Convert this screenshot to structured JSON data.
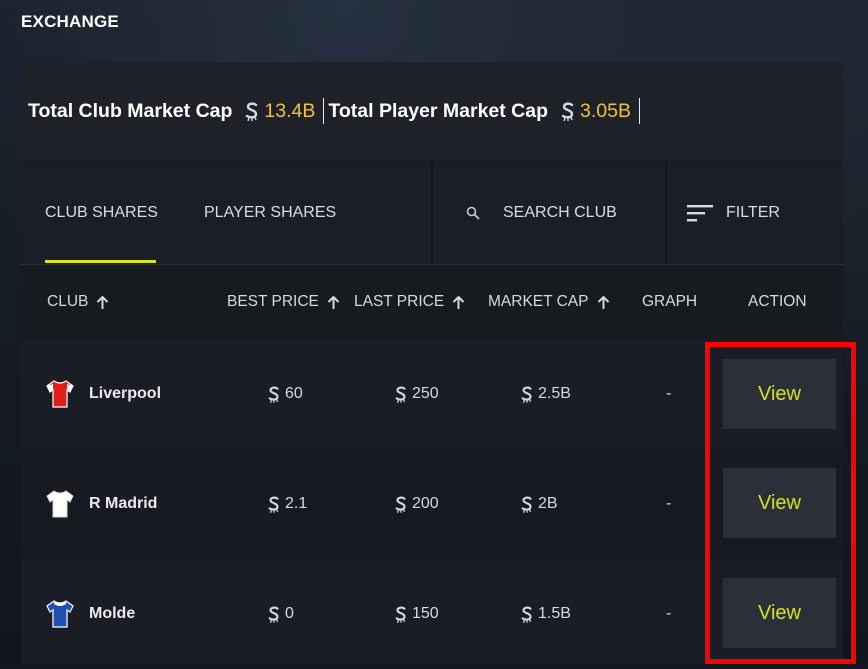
{
  "page": {
    "title": "EXCHANGE"
  },
  "caps": {
    "club_label": "Total Club Market Cap",
    "club_value": "13.4B",
    "player_label": "Total Player Market Cap",
    "player_value": "3.05B"
  },
  "tabs": [
    {
      "label": "CLUB SHARES",
      "active": true
    },
    {
      "label": "PLAYER SHARES",
      "active": false
    }
  ],
  "search": {
    "label": "SEARCH CLUB",
    "icon": "search-icon"
  },
  "filter": {
    "label": "FILTER",
    "icon": "filter-icon"
  },
  "columns": {
    "club": "CLUB",
    "best_price": "BEST PRICE",
    "last_price": "LAST PRICE",
    "market_cap": "MARKET CAP",
    "graph": "GRAPH",
    "action": "ACTION"
  },
  "rows": [
    {
      "club": "Liverpool",
      "shirt": "red-shirt-icon",
      "best_price": "60",
      "last_price": "250",
      "market_cap": "2.5B",
      "graph": "-",
      "action": "View"
    },
    {
      "club": "R Madrid",
      "shirt": "white-shirt-icon",
      "best_price": "2.1",
      "last_price": "200",
      "market_cap": "2B",
      "graph": "-",
      "action": "View"
    },
    {
      "club": "Molde",
      "shirt": "blue-shirt-icon",
      "best_price": "0",
      "last_price": "150",
      "market_cap": "1.5B",
      "graph": "-",
      "action": "View"
    }
  ],
  "colors": {
    "accent_yellow": "#d6e01a",
    "cap_value_gold": "#f2c12e",
    "highlight_red": "#ff0000"
  }
}
